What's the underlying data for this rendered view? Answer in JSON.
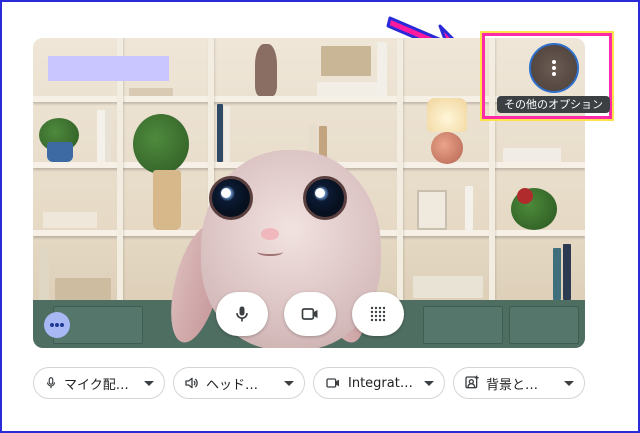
{
  "more_options": {
    "tooltip": "その他のオプション",
    "icon": "more-vert-icon"
  },
  "preview": {
    "name_tag_color": "#c9c5ff",
    "background": "bookshelf"
  },
  "controls": {
    "microphone": {
      "icon": "microphone-icon"
    },
    "camera": {
      "icon": "videocam-icon"
    },
    "effects": {
      "icon": "dot-grid-icon"
    },
    "more_dots": {
      "icon": "three-dots-icon"
    }
  },
  "device_bar": [
    {
      "icon": "microphone-icon",
      "label": "マイク配…"
    },
    {
      "icon": "speaker-icon",
      "label": "ヘッド…"
    },
    {
      "icon": "videocam-icon",
      "label": "Integrat…"
    },
    {
      "icon": "background-icon",
      "label": "背景と…"
    }
  ],
  "colors": {
    "frame": "#2a2ad8",
    "highlight": "#ff2aa8",
    "arrow": "#ff1aa0",
    "arrow_outline": "#2a2ad8"
  }
}
